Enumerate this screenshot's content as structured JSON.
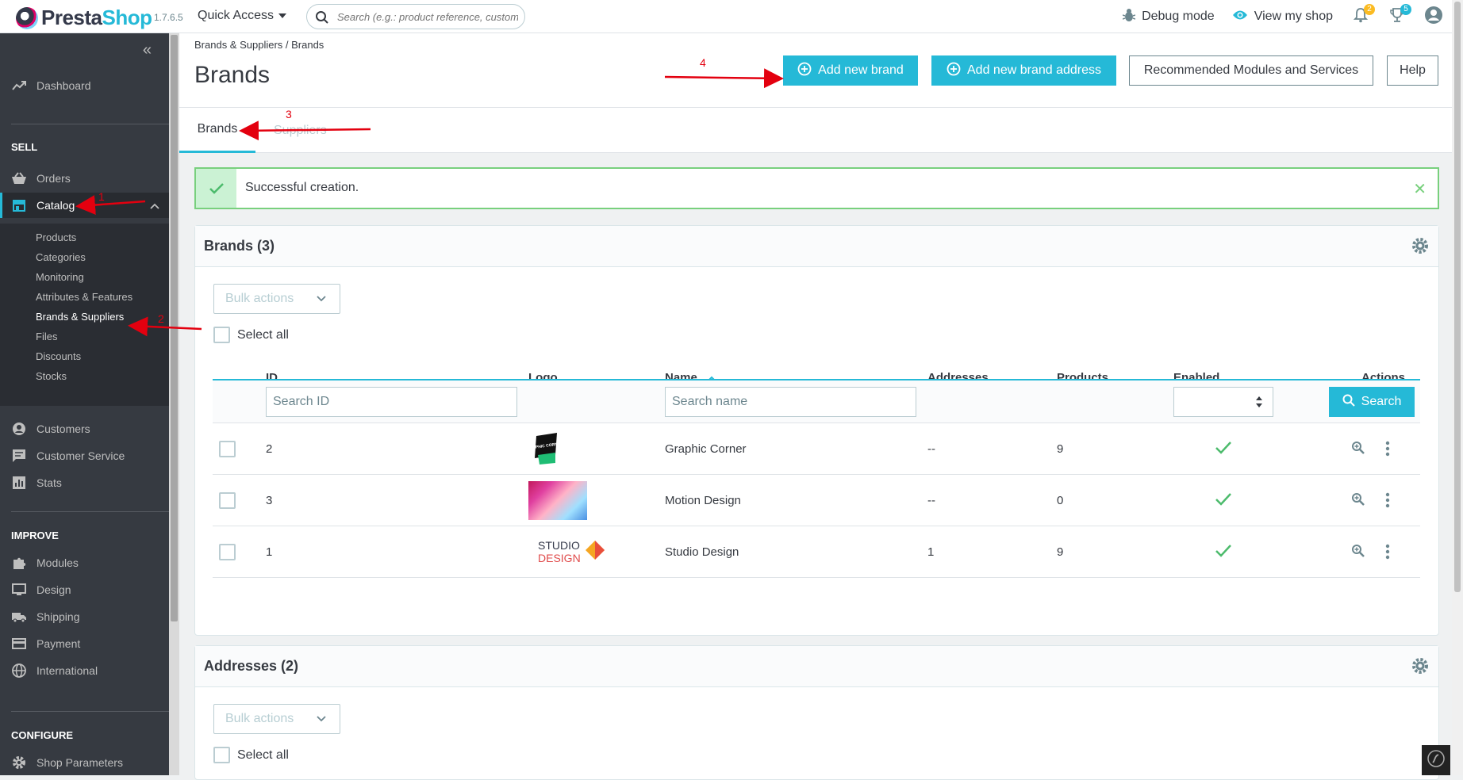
{
  "header": {
    "logo_text_1": "Presta",
    "logo_text_2": "Shop",
    "version": "1.7.6.5",
    "quick_access": "Quick Access",
    "search_placeholder": "Search (e.g.: product reference, custome",
    "debug_mode": "Debug mode",
    "view_my_shop": "View my shop",
    "orders_badge": "2",
    "customers_badge": "5"
  },
  "sidebar": {
    "dashboard": "Dashboard",
    "sell_title": "SELL",
    "orders": "Orders",
    "catalog": "Catalog",
    "catalog_sub": [
      "Products",
      "Categories",
      "Monitoring",
      "Attributes & Features",
      "Brands & Suppliers",
      "Files",
      "Discounts",
      "Stocks"
    ],
    "customers": "Customers",
    "customer_service": "Customer Service",
    "stats": "Stats",
    "improve_title": "IMPROVE",
    "modules": "Modules",
    "design": "Design",
    "shipping": "Shipping",
    "payment": "Payment",
    "international": "International",
    "configure_title": "CONFIGURE",
    "shop_parameters": "Shop Parameters"
  },
  "page": {
    "breadcrumb": "Brands & Suppliers  /  Brands",
    "title": "Brands",
    "buttons": {
      "add_brand": "Add new brand",
      "add_brand_address": "Add new brand address",
      "recommended": "Recommended Modules and Services",
      "help": "Help"
    },
    "tabs": [
      "Brands",
      "Suppliers"
    ]
  },
  "alert": {
    "text": "Successful creation."
  },
  "brands_card": {
    "title": "Brands (3)",
    "bulk_actions": "Bulk actions",
    "select_all": "Select all",
    "columns": [
      "ID",
      "Logo",
      "Name",
      "Addresses",
      "Products",
      "Enabled",
      "Actions"
    ],
    "search_id_placeholder": "Search ID",
    "search_name_placeholder": "Search name",
    "search_button": "Search",
    "rows": [
      {
        "id": "2",
        "name": "Graphic Corner",
        "addresses": "--",
        "products": "9"
      },
      {
        "id": "3",
        "name": "Motion Design",
        "addresses": "--",
        "products": "0"
      },
      {
        "id": "1",
        "name": "Studio Design",
        "addresses": "1",
        "products": "9"
      }
    ],
    "logo_texts": {
      "graphic_corner": "GRAPHIC CORNER",
      "studio_1": "STUDIO",
      "studio_2": "DESIGN"
    }
  },
  "addresses_card": {
    "title": "Addresses (2)",
    "bulk_actions": "Bulk actions",
    "select_all": "Select all"
  },
  "annotations": [
    "1",
    "2",
    "3",
    "4"
  ],
  "colors": {
    "accent": "#25b9d7",
    "sidebar_bg": "#363a41",
    "success": "#78d07d",
    "annotation": "#e3000f"
  }
}
